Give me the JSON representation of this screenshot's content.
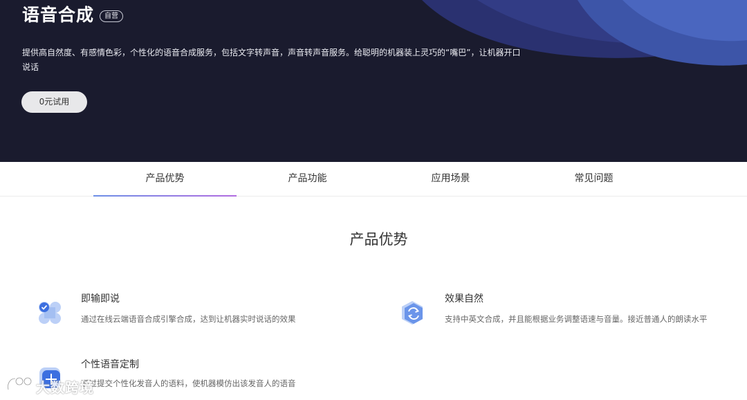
{
  "hero": {
    "title": "语音合成",
    "badge": "自营",
    "description": "提供高自然度、有感情色彩，个性化的语音合成服务，包括文字转声音，声音转声音服务。给聪明的机器装上灵巧的“嘴巴”，让机器开口说话",
    "trial_button": "0元试用"
  },
  "tabs": [
    {
      "label": "产品优势",
      "active": true
    },
    {
      "label": "产品功能",
      "active": false
    },
    {
      "label": "应用场景",
      "active": false
    },
    {
      "label": "常见问题",
      "active": false
    }
  ],
  "section": {
    "title": "产品优势",
    "features": [
      {
        "icon": "grid-check-icon",
        "title": "即输即说",
        "description": "通过在线云端语音合成引擎合成，达到让机器实时说话的效果"
      },
      {
        "icon": "sync-arrows-icon",
        "title": "效果自然",
        "description": "支持中英文合成，并且能根据业务调整语速与音量。接近普通人的朗读水平"
      },
      {
        "icon": "custom-voice-icon",
        "title": "个性语音定制",
        "description": "通过提交个性化发音人的语料，使机器模仿出该发音人的语音"
      }
    ]
  },
  "watermark": {
    "text": "大数跨境"
  },
  "colors": {
    "hero_bg": "#1a1b2e",
    "wave": "#3d55a8",
    "tab_underline_start": "#6c8fe6",
    "tab_underline_end": "#b16be0",
    "icon_blue": "#4a7de8"
  }
}
